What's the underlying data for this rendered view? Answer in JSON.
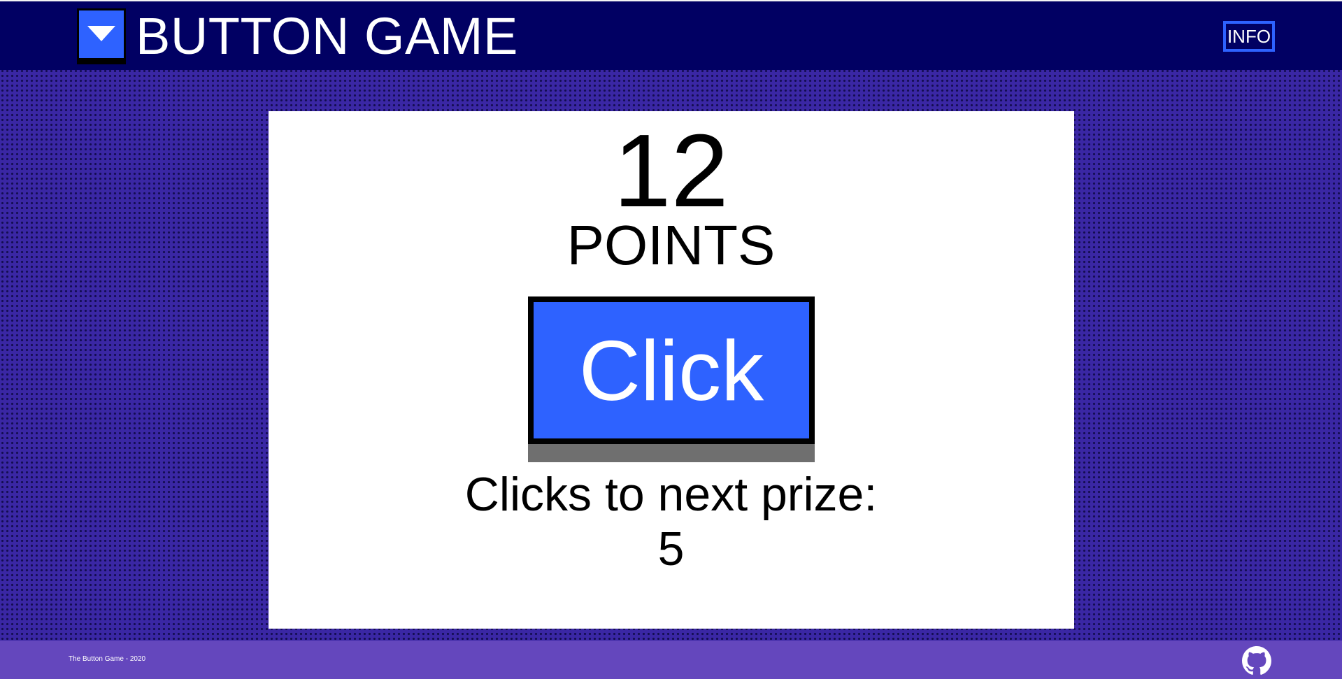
{
  "header": {
    "logo_icon": "caret-down-icon",
    "title": "BUTTON GAME",
    "info_label": "INFO"
  },
  "game": {
    "points": "12",
    "points_label": "POINTS",
    "button_label": "Click",
    "prize_label": "Clicks to next prize:",
    "clicks_to_next_prize": "5"
  },
  "footer": {
    "text": "The Button Game - 2020",
    "github_icon": "github-icon"
  },
  "colors": {
    "header_bg": "#010063",
    "page_bg": "#3a27a4",
    "accent_blue": "#2e62ff",
    "footer_bg": "#6447bd",
    "card_bg": "#ffffff"
  }
}
